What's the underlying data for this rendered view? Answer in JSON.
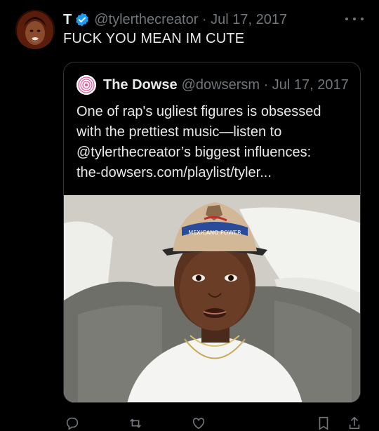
{
  "tweet": {
    "display_name": "T",
    "handle_meta": "@tylerthecreator · Jul 17, 2017",
    "text": "FUCK YOU MEAN IM CUTE"
  },
  "quote": {
    "name": "The Dowse",
    "handle_meta": "@dowsersm · Jul 17, 2017",
    "lines": [
      "One of rap's ugliest figures is obsessed",
      "with the prettiest music—listen to",
      "@tylerthecreator’s biggest influences:",
      "the-dowsers.com/playlist/tyler..."
    ],
    "cap_text": "MEXICANO POWER"
  },
  "icons": {
    "verified": "verified-badge-icon",
    "more": "more-dots-icon",
    "reply": "reply-icon",
    "repost": "repost-icon",
    "like": "like-icon",
    "bookmark": "bookmark-icon",
    "share": "share-icon"
  },
  "colors": {
    "background": "#000000",
    "text": "#e7e9ea",
    "muted": "#71767b",
    "verified": "#1d9bf0",
    "border": "#2f3336"
  }
}
